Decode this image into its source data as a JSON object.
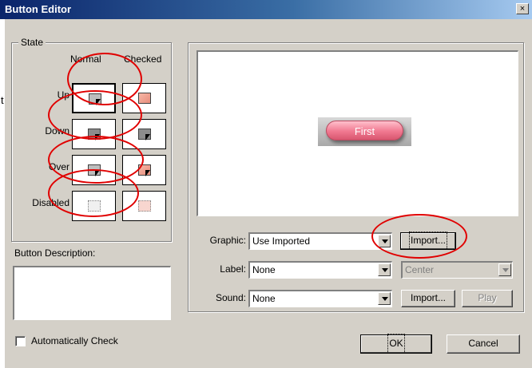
{
  "window": {
    "title": "Button Editor",
    "close_glyph": "×"
  },
  "side_note": "t",
  "state_group": {
    "legend": "State",
    "columns": [
      "Normal",
      "Checked"
    ],
    "rows": [
      "Up",
      "Down",
      "Over",
      "Disabled"
    ]
  },
  "description": {
    "label": "Button Description:",
    "value": ""
  },
  "auto_check": {
    "label": "Automatically Check",
    "checked": false
  },
  "preview": {
    "button_text": "First"
  },
  "graphic": {
    "label": "Graphic:",
    "value": "Use Imported",
    "import_label": "Import..."
  },
  "label_field": {
    "label": "Label:",
    "value": "None",
    "align_value": "Center"
  },
  "sound": {
    "label": "Sound:",
    "value": "None",
    "import_label": "Import...",
    "play_label": "Play"
  },
  "buttons": {
    "ok": "OK",
    "cancel": "Cancel"
  },
  "colors": {
    "titlebar": "#0a246a",
    "dialog": "#d4d0c8",
    "annotation": "#e00000",
    "preview_button": "#f07890"
  }
}
